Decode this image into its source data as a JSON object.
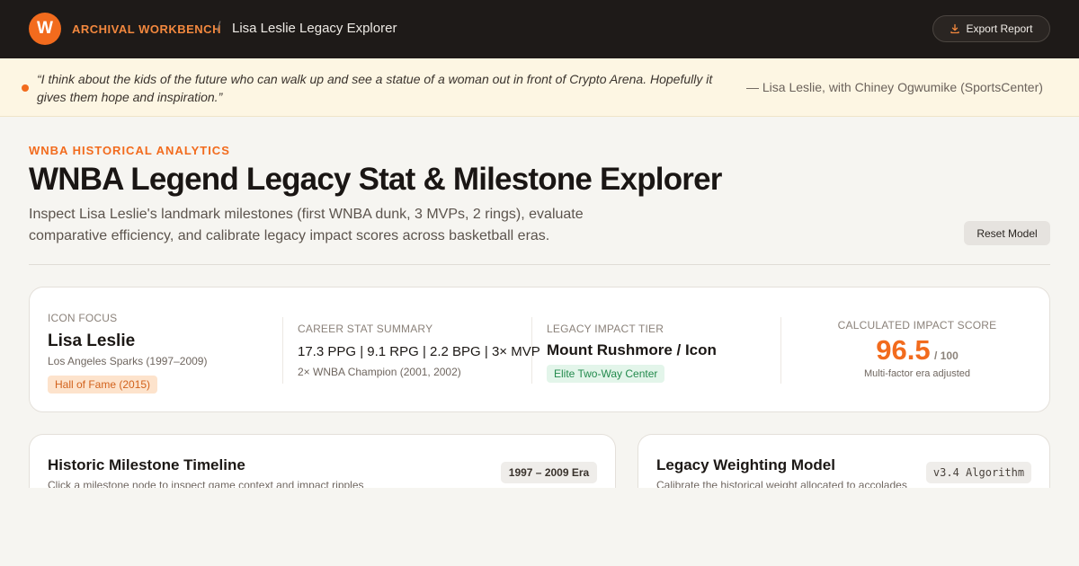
{
  "header": {
    "logo_letter": "W",
    "app_name": "ARCHIVAL WORKBENCH",
    "separator": "/",
    "page_name": "Lisa Leslie Legacy Explorer",
    "export_label": "Export Report"
  },
  "quote": {
    "text": "“I think about the kids of the future who can walk up and see a statue of a woman out in front of Crypto Arena. Hopefully it gives them hope and inspiration.”",
    "attribution": "— Lisa Leslie, with Chiney Ogwumike (SportsCenter)"
  },
  "hero": {
    "eyebrow": "WNBA HISTORICAL ANALYTICS",
    "title": "WNBA Legend Legacy Stat & Milestone Explorer",
    "description": "Inspect Lisa Leslie's landmark milestones (first WNBA dunk, 3 MVPs, 2 rings), evaluate comparative efficiency, and calibrate legacy impact scores across basketball eras.",
    "reset_label": "Reset Model"
  },
  "summary": {
    "focus": {
      "label": "ICON FOCUS",
      "name": "Lisa Leslie",
      "team": "Los Angeles Sparks (1997–2009)",
      "badge": "Hall of Fame (2015)"
    },
    "stats": {
      "label": "CAREER STAT SUMMARY",
      "line": "17.3 PPG | 9.1 RPG | 2.2 BPG | 3× MVP",
      "detail": "2× WNBA Champion (2001, 2002)"
    },
    "tier": {
      "label": "LEGACY IMPACT TIER",
      "value": "Mount Rushmore / Icon",
      "badge": "Elite Two-Way Center"
    },
    "score": {
      "label": "CALCULATED IMPACT SCORE",
      "value": "96.5",
      "max": "/ 100",
      "note": "Multi-factor era adjusted"
    }
  },
  "timeline": {
    "title": "Historic Milestone Timeline",
    "subtitle": "Click a milestone node to inspect game context and impact ripples",
    "era_tag": "1997 – 2009 Era"
  },
  "model": {
    "title": "Legacy Weighting Model",
    "subtitle": "Calibrate the historical weight allocated to accolades",
    "version_tag": "v3.4 Algorithm"
  },
  "colors": {
    "accent": "#f26b1d",
    "topbar": "#1e1a18",
    "quote_bg": "#fdf6e3",
    "page_bg": "#f6f5f1",
    "green_badge": "#238a4d"
  },
  "icons": {
    "export": "download-icon",
    "quote_marker": "dot-icon"
  }
}
